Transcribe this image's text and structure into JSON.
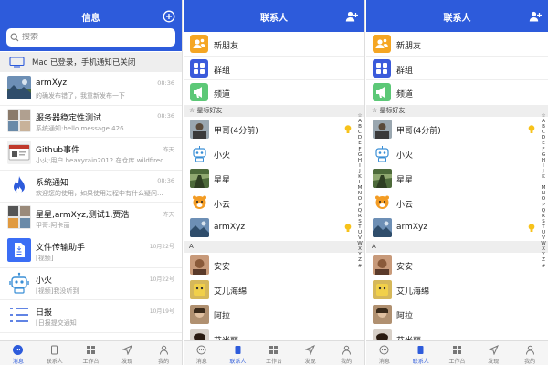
{
  "screen1": {
    "title": "信息",
    "search_placeholder": "搜索",
    "notice": "Mac 已登录，手机通知已关闭",
    "conversations": [
      {
        "name": "armXyz",
        "preview": "的确发布错了，我重新发布一下",
        "time": "08:36"
      },
      {
        "name": "服务器稳定性测试",
        "preview": "系统通知:hello message 426",
        "time": "08:36"
      },
      {
        "name": "Github事件",
        "preview": "小火:用户 heavyrain2012 在仓库 wildfirec...",
        "time": "昨天"
      },
      {
        "name": "系统通知",
        "preview": "欢迎您的使用，如果使用过程中有什么疑问...",
        "time": "08:36"
      },
      {
        "name": "星星,armXyz,测试1,贾浩",
        "preview": "甲哥:阿卡丽",
        "time": "昨天"
      },
      {
        "name": "文件传输助手",
        "preview": "[视频]",
        "time": "10月22号"
      },
      {
        "name": "小火",
        "preview": "[视频]我没听到",
        "time": "10月22号"
      },
      {
        "name": "日报",
        "preview": "[日报提交通知",
        "time": "10月19号"
      }
    ]
  },
  "screen2": {
    "title": "联系人",
    "top_items": [
      {
        "label": "新朋友",
        "icon": "new-friend-icon",
        "color": "#f5a623"
      },
      {
        "label": "群组",
        "icon": "group-icon",
        "color": "#3b5bdb"
      },
      {
        "label": "频道",
        "icon": "channel-icon",
        "color": "#5cc877"
      }
    ],
    "star_section": "☆ 星标好友",
    "starred": [
      {
        "name": "甲哥(4分前)",
        "bulb": true
      },
      {
        "name": "小火",
        "bulb": false
      },
      {
        "name": "星星",
        "bulb": false
      },
      {
        "name": "小云",
        "bulb": false
      },
      {
        "name": "armXyz",
        "bulb": true
      }
    ],
    "a_section": "A",
    "a_contacts": [
      {
        "name": "安安"
      },
      {
        "name": "艾儿海绵"
      },
      {
        "name": "阿拉"
      },
      {
        "name": "艾米丽"
      }
    ],
    "alphabet": [
      "☆",
      "A",
      "B",
      "C",
      "D",
      "E",
      "F",
      "G",
      "H",
      "I",
      "J",
      "K",
      "L",
      "M",
      "N",
      "O",
      "P",
      "Q",
      "R",
      "S",
      "T",
      "U",
      "V",
      "W",
      "X",
      "Y",
      "Z",
      "#"
    ]
  },
  "screen3": {
    "title": "联系人",
    "top_items": [
      {
        "label": "新朋友"
      },
      {
        "label": "群组"
      },
      {
        "label": "频道"
      }
    ],
    "star_section": "☆ 星标好友",
    "starred": [
      {
        "name": "甲哥(4分前)",
        "bulb": true
      },
      {
        "name": "小火",
        "bulb": false
      },
      {
        "name": "星星",
        "bulb": false
      },
      {
        "name": "小云",
        "bulb": false
      },
      {
        "name": "armXyz",
        "bulb": true
      }
    ],
    "a_section": "A",
    "a_contacts": [
      {
        "name": "安安"
      },
      {
        "name": "艾儿海绵"
      },
      {
        "name": "阿拉"
      },
      {
        "name": "艾米丽"
      }
    ],
    "alphabet": [
      "☆",
      "A",
      "B",
      "C",
      "D",
      "E",
      "F",
      "G",
      "H",
      "I",
      "J",
      "K",
      "L",
      "M",
      "N",
      "O",
      "P",
      "Q",
      "R",
      "S",
      "T",
      "U",
      "V",
      "W",
      "X",
      "Y",
      "Z",
      "#"
    ]
  },
  "tabs": [
    "消息",
    "联系人",
    "工作台",
    "发现",
    "我的"
  ],
  "colors": {
    "brand": "#2d5bdb",
    "bulb": "#f7c21a"
  }
}
